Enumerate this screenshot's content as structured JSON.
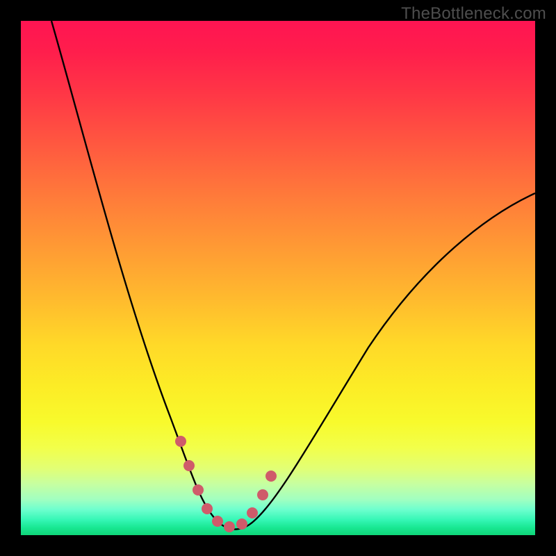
{
  "watermark": "TheBottleneck.com",
  "colors": {
    "frame": "#000000",
    "curve": "#000000",
    "markers": "#cf5b6a"
  },
  "chart_data": {
    "type": "line",
    "title": "",
    "xlabel": "",
    "ylabel": "",
    "xlim": [
      0,
      100
    ],
    "ylim": [
      0,
      100
    ],
    "grid": false,
    "legend": false,
    "annotations": [
      "TheBottleneck.com"
    ],
    "series": [
      {
        "name": "bottleneck-curve",
        "x": [
          6,
          10,
          14,
          18,
          22,
          26,
          29,
          31,
          33,
          35,
          37,
          39,
          41,
          43,
          46,
          50,
          55,
          60,
          66,
          73,
          80,
          88,
          96,
          100
        ],
        "y": [
          100,
          88,
          76,
          64,
          52,
          40,
          30,
          22,
          14,
          8,
          4,
          2,
          2,
          4,
          8,
          14,
          22,
          30,
          38,
          46,
          53,
          59,
          64,
          66
        ]
      }
    ],
    "markers": {
      "name": "highlight-dots",
      "points": [
        {
          "x": 31,
          "y": 18
        },
        {
          "x": 33,
          "y": 10
        },
        {
          "x": 35,
          "y": 5
        },
        {
          "x": 37,
          "y": 2
        },
        {
          "x": 39,
          "y": 2
        },
        {
          "x": 41,
          "y": 2
        },
        {
          "x": 43,
          "y": 5
        },
        {
          "x": 45,
          "y": 9
        },
        {
          "x": 47,
          "y": 14
        },
        {
          "x": 49,
          "y": 19
        }
      ]
    }
  }
}
